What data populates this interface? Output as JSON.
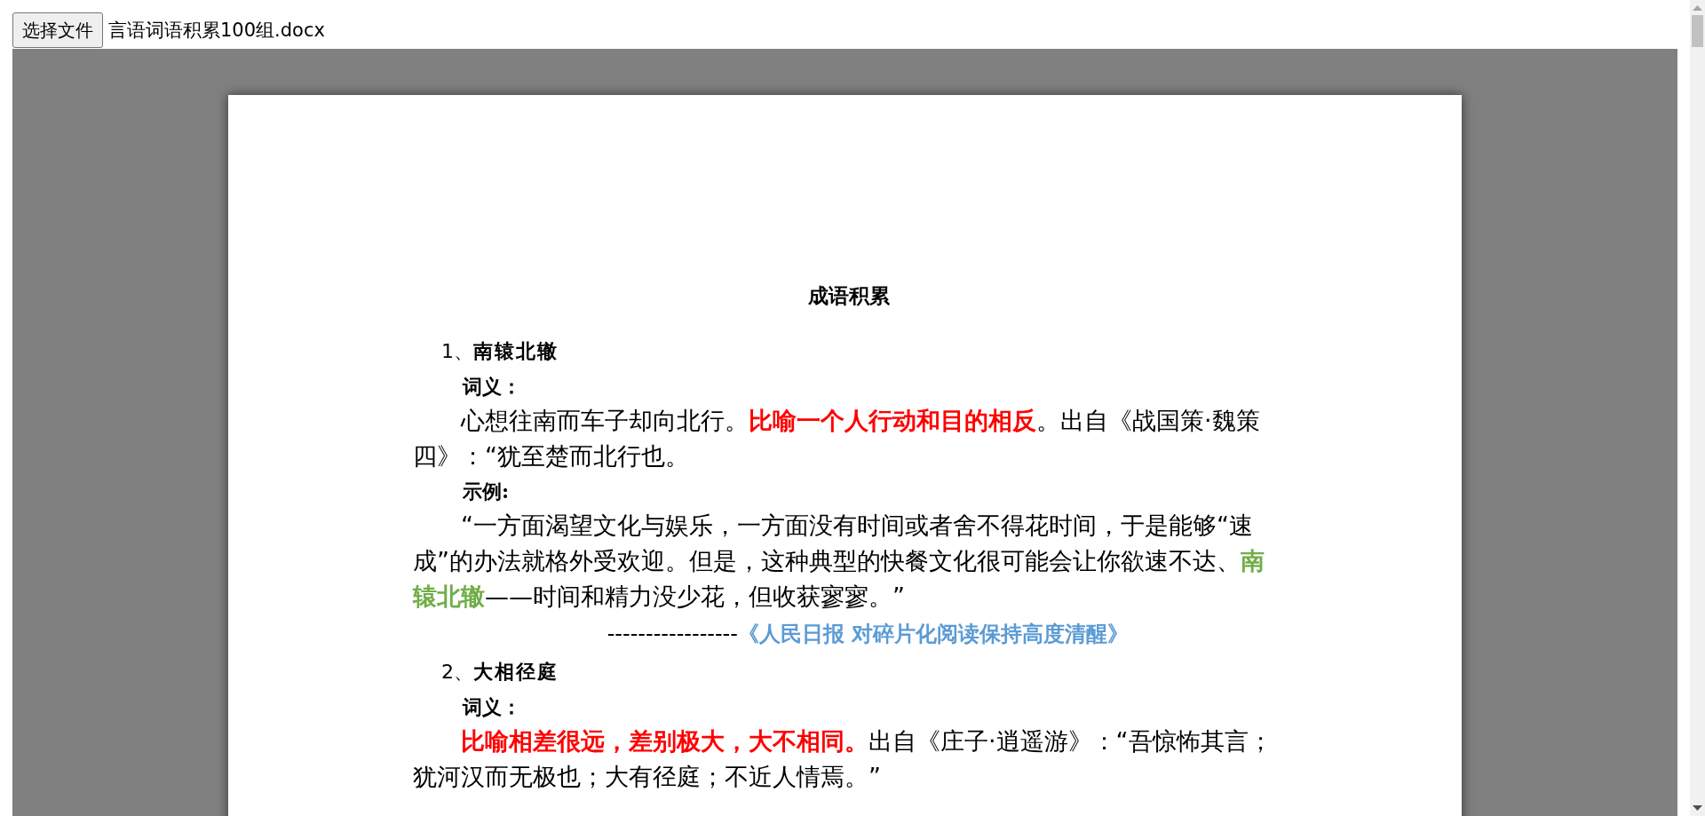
{
  "file_input": {
    "button": "选择文件",
    "filename": "言语词语积累100组.docx"
  },
  "document": {
    "title": "成语积累",
    "blocks": [
      {
        "kind": "heading",
        "number": "1、",
        "text": "南辕北辙"
      },
      {
        "kind": "label",
        "text": "词义："
      },
      {
        "kind": "paragraph",
        "segments": [
          {
            "text": "心想往南而车子却向北行。"
          },
          {
            "text": "比喻一个人行动和目的相反",
            "color": "#ff0000"
          },
          {
            "text": "。出自《战国策·魏策四》：“犹至楚而北行也。"
          }
        ]
      },
      {
        "kind": "label",
        "text": "示例:"
      },
      {
        "kind": "paragraph",
        "segments": [
          {
            "text": "“一方面渴望文化与娱乐，一方面没有时间或者舍不得花时间，于是能够“速成”的办法就格外受欢迎。但是，这种典型的快餐文化很可能会让你欲速不达、"
          },
          {
            "text": "南辕北辙",
            "color": "#70ad47"
          },
          {
            "text": "——时间和精力没少花，但收获寥寥。”"
          }
        ]
      },
      {
        "kind": "source",
        "segments": [
          {
            "text": "-----------------"
          },
          {
            "text": "《人民日报  对碎片化阅读保持高度清醒》",
            "color": "#5b9bd5"
          }
        ]
      },
      {
        "kind": "heading",
        "number": "2、",
        "text": "大相径庭"
      },
      {
        "kind": "label",
        "text": "词义："
      },
      {
        "kind": "paragraph",
        "segments": [
          {
            "text": "比喻相差很远，差别极大，大不相同。",
            "color": "#ff0000"
          },
          {
            "text": "出自《庄子·逍遥游》：“吾惊怖其言；犹河汉而无极也；大有径庭；不近人情焉。”"
          }
        ]
      }
    ]
  }
}
